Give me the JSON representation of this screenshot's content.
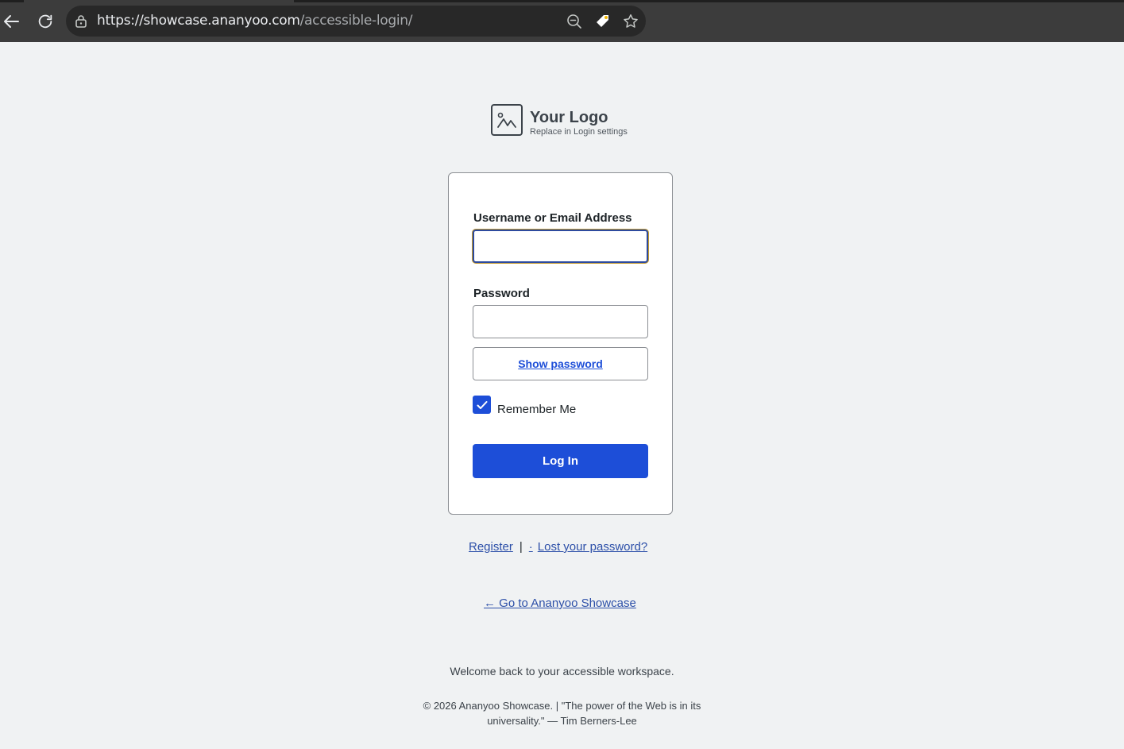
{
  "browser": {
    "url_host": "https://showcase.ananyoo.com",
    "url_path": "/accessible-login/"
  },
  "logo": {
    "title": "Your Logo",
    "subtitle": "Replace in Login settings"
  },
  "form": {
    "username_label": "Username or Email Address",
    "username_value": "",
    "password_label": "Password",
    "password_value": "",
    "show_password_label": "Show password",
    "remember_label": "Remember Me",
    "remember_checked": true,
    "login_label": "Log In"
  },
  "links": {
    "register": "Register",
    "separator": "|",
    "lost_dot": "·",
    "lost_password": "Lost your password?",
    "back_to_site": "← Go to Ananyoo Showcase"
  },
  "welcome": "Welcome back to your accessible workspace.",
  "footer": {
    "line1": "© 2026 Ananyoo Showcase. | \"The power of the Web is in its",
    "line2": "universality.\" — Tim Berners-Lee"
  },
  "colors": {
    "primary": "#1d4ed8",
    "link": "#2c4fa8",
    "background": "#f0f2f3"
  }
}
